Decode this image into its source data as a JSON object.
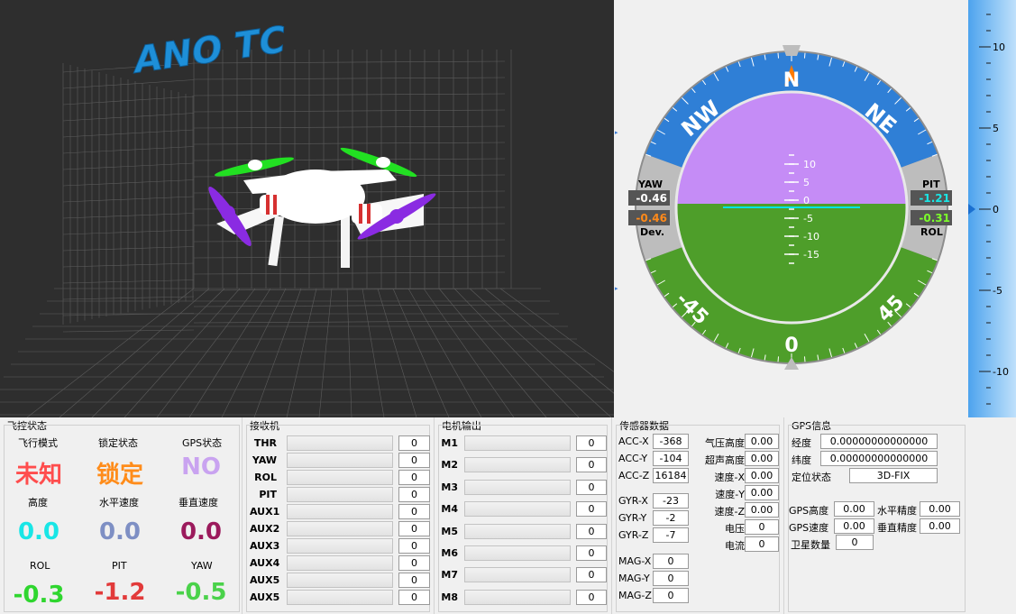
{
  "view3d": {
    "logo": "ANO TC"
  },
  "hud": {
    "compass": [
      "N",
      "NE",
      "NW"
    ],
    "roll_scale": [
      "-45",
      "45",
      "0"
    ],
    "pitch_ticks": [
      "10",
      "5",
      "0",
      "-5",
      "-10",
      "-15"
    ],
    "yaw_label": "YAW",
    "yaw_value": "-0.46",
    "dev_value": "-0.46",
    "dev_label": "Dev.",
    "pit_label": "PIT",
    "pit_value": "-1.21",
    "rol_value": "-0.31",
    "rol_label": "ROL",
    "pitch_deg": -1.21,
    "roll_deg": -0.31,
    "colors": {
      "sky": "#c58cf6",
      "ground": "#4e9e2a",
      "ring_top": "#2f7fd6",
      "ring_bottom": "#4e9e2a",
      "horizon": "#00e5e5"
    }
  },
  "altitude_scale": {
    "ticks": [
      "10",
      "5",
      "0",
      "-5",
      "-10"
    ],
    "value": 0.0
  },
  "fc": {
    "title": "飞控状态",
    "items": [
      {
        "label": "飞行模式",
        "value": "未知",
        "color": "#ff4d4d"
      },
      {
        "label": "锁定状态",
        "value": "锁定",
        "color": "#ff8c1a"
      },
      {
        "label": "GPS状态",
        "value": "NO",
        "color": "#c9a3f0"
      },
      {
        "label": "高度",
        "value": "0.0",
        "color": "#19e6e6"
      },
      {
        "label": "水平速度",
        "value": "0.0",
        "color": "#7e8fc4"
      },
      {
        "label": "垂直速度",
        "value": "0.0",
        "color": "#9b1a5c"
      },
      {
        "label": "ROL",
        "value": "-0.3",
        "color": "#2fd62f"
      },
      {
        "label": "PIT",
        "value": "-1.2",
        "color": "#e23a3a"
      },
      {
        "label": "YAW",
        "value": "-0.5",
        "color": "#4ad24a"
      }
    ]
  },
  "rc": {
    "title": "接收机",
    "channels": [
      {
        "name": "THR",
        "value": "0"
      },
      {
        "name": "YAW",
        "value": "0"
      },
      {
        "name": "ROL",
        "value": "0"
      },
      {
        "name": "PIT",
        "value": "0"
      },
      {
        "name": "AUX1",
        "value": "0"
      },
      {
        "name": "AUX2",
        "value": "0"
      },
      {
        "name": "AUX3",
        "value": "0"
      },
      {
        "name": "AUX4",
        "value": "0"
      },
      {
        "name": "AUX5",
        "value": "0"
      },
      {
        "name": "AUX5",
        "value": "0"
      }
    ]
  },
  "motor": {
    "title": "电机输出",
    "channels": [
      {
        "name": "M1",
        "value": "0"
      },
      {
        "name": "M2",
        "value": "0"
      },
      {
        "name": "M3",
        "value": "0"
      },
      {
        "name": "M4",
        "value": "0"
      },
      {
        "name": "M5",
        "value": "0"
      },
      {
        "name": "M6",
        "value": "0"
      },
      {
        "name": "M7",
        "value": "0"
      },
      {
        "name": "M8",
        "value": "0"
      }
    ]
  },
  "sensor": {
    "title": "传感器数据",
    "acc": [
      {
        "label": "ACC-X",
        "value": "-368"
      },
      {
        "label": "ACC-Y",
        "value": "-104"
      },
      {
        "label": "ACC-Z",
        "value": "16184"
      }
    ],
    "gyr": [
      {
        "label": "GYR-X",
        "value": "-23"
      },
      {
        "label": "GYR-Y",
        "value": "-2"
      },
      {
        "label": "GYR-Z",
        "value": "-7"
      }
    ],
    "mag": [
      {
        "label": "MAG-X",
        "value": "0"
      },
      {
        "label": "MAG-Y",
        "value": "0"
      },
      {
        "label": "MAG-Z",
        "value": "0"
      }
    ],
    "misc": [
      {
        "label": "气压高度",
        "value": "0.00"
      },
      {
        "label": "超声高度",
        "value": "0.00"
      },
      {
        "label": "速度-X",
        "value": "0.00"
      },
      {
        "label": "速度-Y",
        "value": "0.00"
      },
      {
        "label": "速度-Z",
        "value": "0.00"
      },
      {
        "label": "电压",
        "value": "0"
      },
      {
        "label": "电流",
        "value": "0"
      }
    ]
  },
  "gps": {
    "title": "GPS信息",
    "lon_label": "经度",
    "lon": "0.00000000000000",
    "lat_label": "纬度",
    "lat": "0.00000000000000",
    "fix_label": "定位状态",
    "fix": "3D-FIX",
    "alt_label": "GPS高度",
    "alt": "0.00",
    "hacc_label": "水平精度",
    "hacc": "0.00",
    "spd_label": "GPS速度",
    "spd": "0.00",
    "vacc_label": "垂直精度",
    "vacc": "0.00",
    "sats_label": "卫星数量",
    "sats": "0"
  }
}
